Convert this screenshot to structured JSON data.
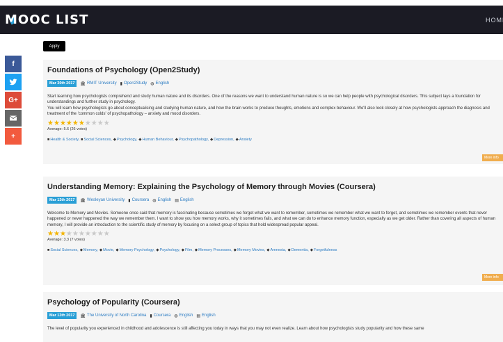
{
  "header": {
    "logo": "MOOC LIST",
    "nav_home": "HOME"
  },
  "apply_label": "Apply",
  "social": [
    {
      "name": "facebook",
      "glyph": "f",
      "color": "#3b5998"
    },
    {
      "name": "twitter",
      "glyph": "",
      "color": "#1da1f2"
    },
    {
      "name": "google-plus",
      "glyph": "G+",
      "color": "#dd4b39"
    },
    {
      "name": "email",
      "glyph": "",
      "color": "#666666"
    },
    {
      "name": "more",
      "glyph": "+",
      "color": "#f25a3e"
    }
  ],
  "more_info_label": "More info",
  "courses": [
    {
      "title": "Foundations of Psychology (Open2Study)",
      "date": "Mar 30th 2017",
      "university": "RMIT University",
      "provider": "Open2Study",
      "language": "English",
      "subtitle": "",
      "description": "Start learning how psychologists comprehend and study human nature and its disorders. One of the reasons we want to understand human nature is so we can help people with psychological disorders. This subject lays a foundation for understandings and further study in psychology.\nYou will learn how psychologists go about conceptualising and studying human nature, and how the brain works to produce thoughts, emotions and complex behaviour. We'll also look closely at how psychologists approach the diagnosis and treatment of the 'common colds' of psychopathology – anxiety and mood disorders.",
      "rating": 5.6,
      "average_text": "Average: 5.6 (26 votes)",
      "categories": [
        "Health & Society",
        "Social Sciences"
      ],
      "tags": [
        "Psychology",
        "Human Behaviour",
        "Psychopathology",
        "Depression",
        "Anxiety"
      ]
    },
    {
      "title": "Understanding Memory: Explaining the Psychology of Memory through Movies (Coursera)",
      "date": "Mar 13th 2017",
      "university": "Wesleyan University",
      "provider": "Coursera",
      "language": "English",
      "subtitle": "English",
      "description": "Welcome to Memory and Movies. Someone once said that memory is fascinating because sometimes we forget what we want to remember, sometimes we remember what we want to forget, and sometimes we remember events that never happened or never happened the way we remember them. I want to show you how memory works, why it sometimes fails, and what we can do to enhance memory function, especially as we get older. Rather than covering all aspects of human memory, I will provide an introduction to the scientific study of memory by focusing on a select group of topics that hold widespread popular appeal.",
      "rating": 3.3,
      "average_text": "Average: 3.3 (7 votes)",
      "categories": [
        "Social Sciences"
      ],
      "tags": [
        "Memory",
        "Movie",
        "Memory Psychology",
        "Psychology",
        "Film",
        "Memory Processes",
        "Memory Movies",
        "Amnesia",
        "Dementia",
        "Forgetfulness"
      ]
    },
    {
      "title": "Psychology of Popularity (Coursera)",
      "date": "Mar 13th 2017",
      "university": "The University of North Carolina",
      "provider": "Coursera",
      "language": "English",
      "subtitle": "English",
      "description": "The level of popularity you experienced in childhood and adolescence is still affecting you today in ways that you may not even realize. Learn about how psychologists study popularity and how these same",
      "rating": 0,
      "average_text": "",
      "categories": [],
      "tags": []
    }
  ]
}
